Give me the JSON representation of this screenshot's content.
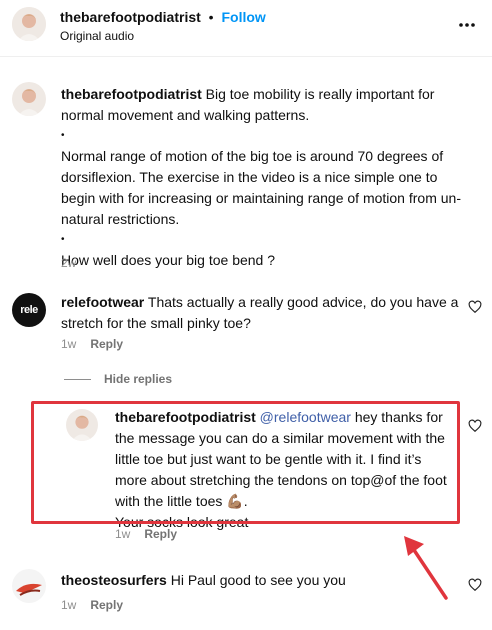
{
  "header": {
    "username": "thebarefootpodiatrist",
    "separator": "•",
    "follow_label": "Follow",
    "audio_label": "Original audio",
    "more_icon": "more-horizontal-icon"
  },
  "caption": {
    "username": "thebarefootpodiatrist",
    "line1": " Big toe mobility is really important for normal movement and walking patterns.",
    "bullet1": "•",
    "para2": "Normal range of motion of the big toe is around 70 degrees of dorsiflexion. The exercise in the video is a nice simple one to begin with for increasing or maintaining range of motion from un-natural restrictions.",
    "bullet2": "•",
    "para3": "How well does your big toe bend ?",
    "time": "2w"
  },
  "comments": [
    {
      "username": "relefootwear",
      "avatar_text": "rele",
      "text": " Thats actually a really good advice, do you have a stretch for the small pinky toe?",
      "time": "1w",
      "reply_label": "Reply"
    },
    {
      "username": "theosteosurfers",
      "text": " Hi Paul good to see you you",
      "time": "1w",
      "reply_label": "Reply"
    }
  ],
  "hide_replies_label": "Hide replies",
  "reply": {
    "username": "thebarefootpodiatrist",
    "mention": "@relefootwear",
    "text": " hey thanks for the message you can do a similar movement with the little toe but just want to be gentle with it. I find it’s more about stretching the tendons on top@of the foot with the little toes 💪🏽.",
    "text2": "Your socks look great",
    "time": "1w",
    "reply_label": "Reply"
  },
  "colors": {
    "follow": "#0095f6",
    "highlight_box": "#e0353d",
    "arrow": "#e0353d",
    "meta": "#8e8e8e"
  },
  "icons": {
    "like": "heart-outline-icon"
  }
}
